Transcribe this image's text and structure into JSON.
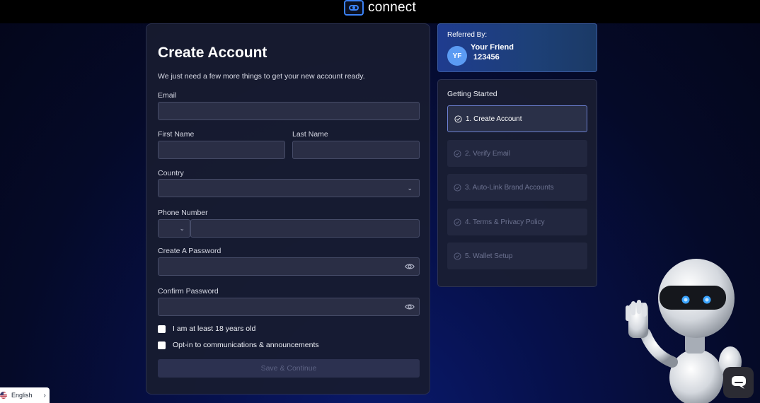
{
  "brand": {
    "name": "connect",
    "accent": "#3b82f6"
  },
  "form": {
    "title": "Create Account",
    "subtitle": "We just need a few more things to get your new account ready.",
    "email_label": "Email",
    "email_value": "",
    "first_name_label": "First Name",
    "first_name_value": "",
    "last_name_label": "Last Name",
    "last_name_value": "",
    "country_label": "Country",
    "country_value": "",
    "phone_label": "Phone Number",
    "phone_code_value": "",
    "phone_value": "",
    "password_label": "Create A Password",
    "password_value": "",
    "confirm_label": "Confirm Password",
    "confirm_value": "",
    "age_check_label": "I am at least 18 years old",
    "optin_label": "Opt-in to communications & announcements",
    "save_label": "Save & Continue"
  },
  "referral": {
    "label": "Referred By:",
    "initials": "YF",
    "name": "Your Friend",
    "code": "123456"
  },
  "steps": {
    "title": "Getting Started",
    "items": [
      {
        "label": "1. Create Account",
        "active": true
      },
      {
        "label": "2. Verify Email",
        "active": false
      },
      {
        "label": "3. Auto-Link Brand Accounts",
        "active": false
      },
      {
        "label": "4. Terms & Privacy Policy",
        "active": false
      },
      {
        "label": "5. Wallet Setup",
        "active": false
      }
    ]
  },
  "language": {
    "selected": "English"
  }
}
